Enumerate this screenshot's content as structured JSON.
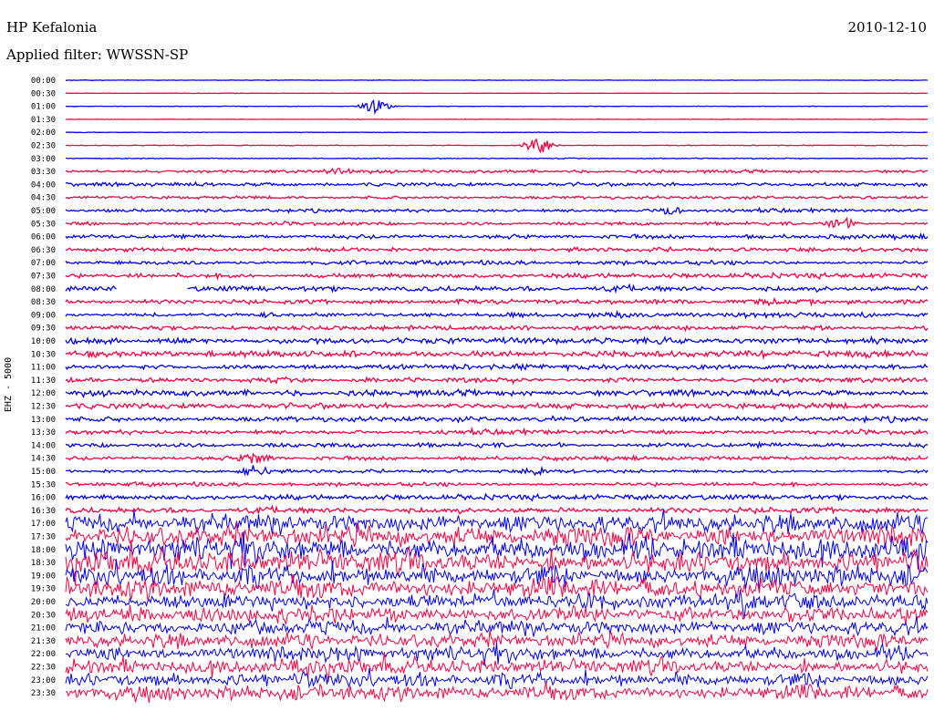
{
  "header": {
    "station": "HP Kefalonia",
    "date": "2010-12-10",
    "filter_text": "Applied filter: WWSSN-SP"
  },
  "channel_label": "EHZ - 5000",
  "colors": {
    "trace_a": "#0000ff",
    "trace_b": "#ff0040",
    "background": "#ffffff",
    "text": "#000000"
  },
  "chart_data": {
    "type": "helicorder",
    "row_labels": [
      "00:00",
      "00:30",
      "01:00",
      "01:30",
      "02:00",
      "02:30",
      "03:00",
      "03:30",
      "04:00",
      "04:30",
      "05:00",
      "05:30",
      "06:00",
      "06:30",
      "07:00",
      "07:30",
      "08:00",
      "08:30",
      "09:00",
      "09:30",
      "10:00",
      "10:30",
      "11:00",
      "11:30",
      "12:00",
      "12:30",
      "13:00",
      "13:30",
      "14:00",
      "14:30",
      "15:00",
      "15:30",
      "16:00",
      "16:30",
      "17:00",
      "17:30",
      "18:00",
      "18:30",
      "19:00",
      "19:30",
      "20:00",
      "20:30",
      "21:00",
      "21:30",
      "22:00",
      "22:30",
      "23:00",
      "23:30"
    ],
    "series_colors": [
      "#0000ff",
      "#ff0040"
    ],
    "relative_activity": [
      0.2,
      0.2,
      0.2,
      0.2,
      0.2,
      0.3,
      0.4,
      1.2,
      1.5,
      1.2,
      1.3,
      1.4,
      1.6,
      1.5,
      1.6,
      1.9,
      2.1,
      1.8,
      2.0,
      2.1,
      2.4,
      2.4,
      2.1,
      2.0,
      2.3,
      2.3,
      2.0,
      1.8,
      1.9,
      1.5,
      1.2,
      1.5,
      2.0,
      2.3,
      7.0,
      8.0,
      9.0,
      8.5,
      8.0,
      7.5,
      6.5,
      6.0,
      5.5,
      5.5,
      5.5,
      5.5,
      5.5,
      5.5
    ],
    "events": [
      {
        "row": 2,
        "position": 0.36,
        "strength": 3.5
      },
      {
        "row": 5,
        "position": 0.55,
        "strength": 4.5
      },
      {
        "row": 7,
        "position": 0.32,
        "strength": 1.5
      },
      {
        "row": 10,
        "position": 0.7,
        "strength": 2.0
      },
      {
        "row": 11,
        "position": 0.9,
        "strength": 2.5
      },
      {
        "row": 29,
        "position": 0.22,
        "strength": 2.5
      },
      {
        "row": 30,
        "position": 0.22,
        "strength": 3.0
      },
      {
        "row": 30,
        "position": 0.55,
        "strength": 1.5
      }
    ],
    "gaps": [
      {
        "row": 16,
        "start": 0.06,
        "end": 0.14
      }
    ]
  }
}
